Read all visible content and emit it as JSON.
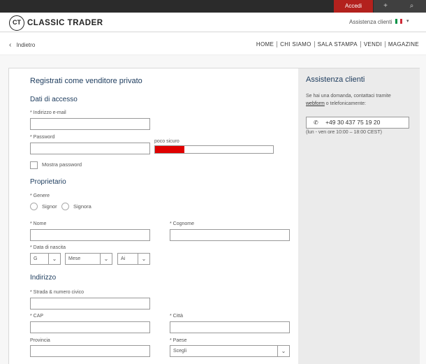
{
  "topbar": {
    "login": "Accedi",
    "plus_icon": "+",
    "search_icon": "⌕"
  },
  "header": {
    "logo_mark": "CT",
    "logo_text": "CLASSIC TRADER",
    "help": "Assistenza clienti",
    "lang_caret": "▾",
    "flag_colors": [
      "#009246",
      "#ffffff",
      "#ce2b37"
    ]
  },
  "nav": {
    "back": "Indietro",
    "items": [
      "HOME",
      "CHI SIAMO",
      "SALA STAMPA",
      "VENDI",
      "MAGAZINE"
    ]
  },
  "form": {
    "title": "Registrati come venditore privato",
    "access": {
      "heading": "Dati di accesso",
      "email_label": "* Indirizzo e-mail",
      "password_label": "* Password",
      "strength_label": "poco sicuro",
      "strength_fraction": 0.25,
      "show_password": "Mostra password"
    },
    "owner": {
      "heading": "Proprietario",
      "gender_label": "* Genere",
      "mr": "Signor",
      "mrs": "Signora",
      "first_name": "* Nome",
      "last_name": "* Cognome",
      "dob_label": "* Data di nascita",
      "dob_day": "G",
      "dob_month": "Mese",
      "dob_year": "Ai"
    },
    "address": {
      "heading": "Indirizzo",
      "street": "* Strada & numero civico",
      "zip": "* CAP",
      "city": "* Città",
      "province": "Provincia",
      "country": "* Paese",
      "country_value": "Scegli"
    }
  },
  "support": {
    "title": "Assistenza clienti",
    "text_pre": "Se hai una domanda, contattaci tramite",
    "text_link": "webform",
    "text_post": "o telefonicamente:",
    "phone": "+49 30 437 75 19 20",
    "hours": "(lun - ven ore 10:00 – 18:00 CEST)"
  }
}
